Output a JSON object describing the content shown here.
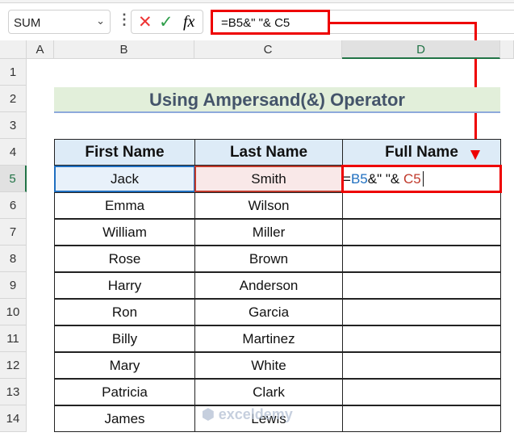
{
  "formula_bar": {
    "name_box": "SUM",
    "formula": "=B5&\" \"& C5",
    "cancel_icon": "✕",
    "enter_icon": "✓",
    "fx_label": "fx"
  },
  "columns": [
    "A",
    "B",
    "C",
    "D"
  ],
  "rows": [
    "1",
    "2",
    "3",
    "4",
    "5",
    "6",
    "7",
    "8",
    "9",
    "10",
    "11",
    "12",
    "13",
    "14"
  ],
  "title": "Using Ampersand(&) Operator",
  "table": {
    "headers": [
      "First Name",
      "Last Name",
      "Full Name"
    ],
    "rows": [
      [
        "Jack",
        "Smith"
      ],
      [
        "Emma",
        "Wilson"
      ],
      [
        "William",
        "Miller"
      ],
      [
        "Rose",
        "Brown"
      ],
      [
        "Harry",
        "Anderson"
      ],
      [
        "Ron",
        "Garcia"
      ],
      [
        "Billy",
        "Martinez"
      ],
      [
        "Mary",
        "White"
      ],
      [
        "Patricia",
        "Clark"
      ],
      [
        "James",
        "Lewis"
      ]
    ]
  },
  "editing": {
    "eq": "=",
    "ref1": "B5",
    "mid": "&\" \"& ",
    "ref2": "C5"
  },
  "watermark": "exceldemy",
  "colors": {
    "highlight": "#e00000",
    "ref1": "#1f6fc0",
    "ref2": "#c0392b"
  }
}
